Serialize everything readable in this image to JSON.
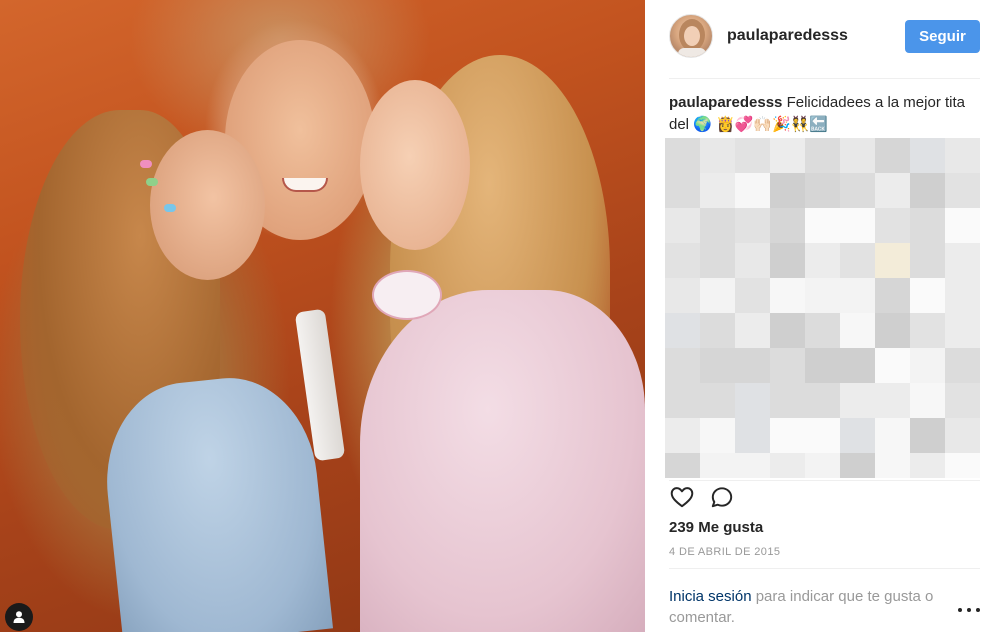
{
  "post": {
    "username": "paulaparedesss",
    "follow_label": "Seguir",
    "caption": {
      "username": "paulaparedesss",
      "text": "Felicidadees a la mejor tita del 🌍 👸💞🙌🏻🎉👯🔙"
    },
    "likes": "239 Me gusta",
    "date": "4 DE ABRIL DE 2015"
  },
  "footer": {
    "login_link": "Inicia sesión",
    "login_rest": " para indicar que te gusta o comentar."
  },
  "icons": {
    "like": "heart-icon",
    "comment": "comment-icon",
    "more": "more-options-icon",
    "user_badge": "user-icon"
  },
  "colors": {
    "follow_button": "#4b95ea",
    "link": "#003569",
    "muted_text": "#999999"
  }
}
